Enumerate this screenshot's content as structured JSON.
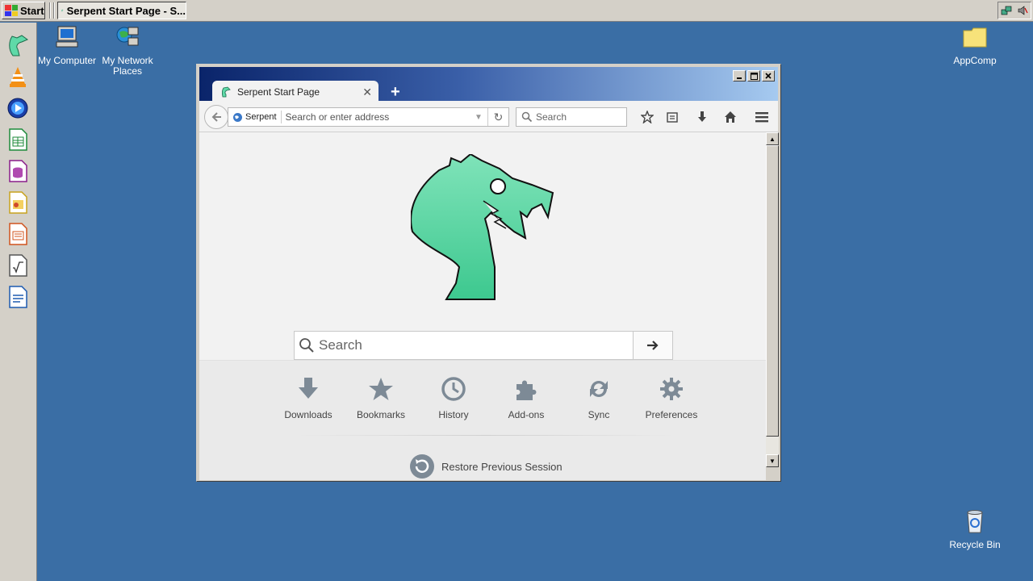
{
  "taskbar": {
    "start_label": "Start",
    "task_title": "Serpent Start Page - S..."
  },
  "desktop": {
    "icons": [
      {
        "label": "My Computer"
      },
      {
        "label": "My Network Places"
      },
      {
        "label": "AppComp"
      },
      {
        "label": "Recycle Bin"
      }
    ]
  },
  "browser": {
    "tab_title": "Serpent Start Page",
    "identity_label": "Serpent",
    "url_placeholder": "Search or enter address",
    "search_placeholder": "Search",
    "page": {
      "search_placeholder": "Search",
      "launcher_items": [
        {
          "label": "Downloads"
        },
        {
          "label": "Bookmarks"
        },
        {
          "label": "History"
        },
        {
          "label": "Add-ons"
        },
        {
          "label": "Sync"
        },
        {
          "label": "Preferences"
        }
      ],
      "restore_label": "Restore Previous Session"
    }
  },
  "colors": {
    "desktop_bg": "#3a6ea5",
    "dragon_green": "#5fd9a8",
    "icon_gray": "#7d8a96"
  }
}
